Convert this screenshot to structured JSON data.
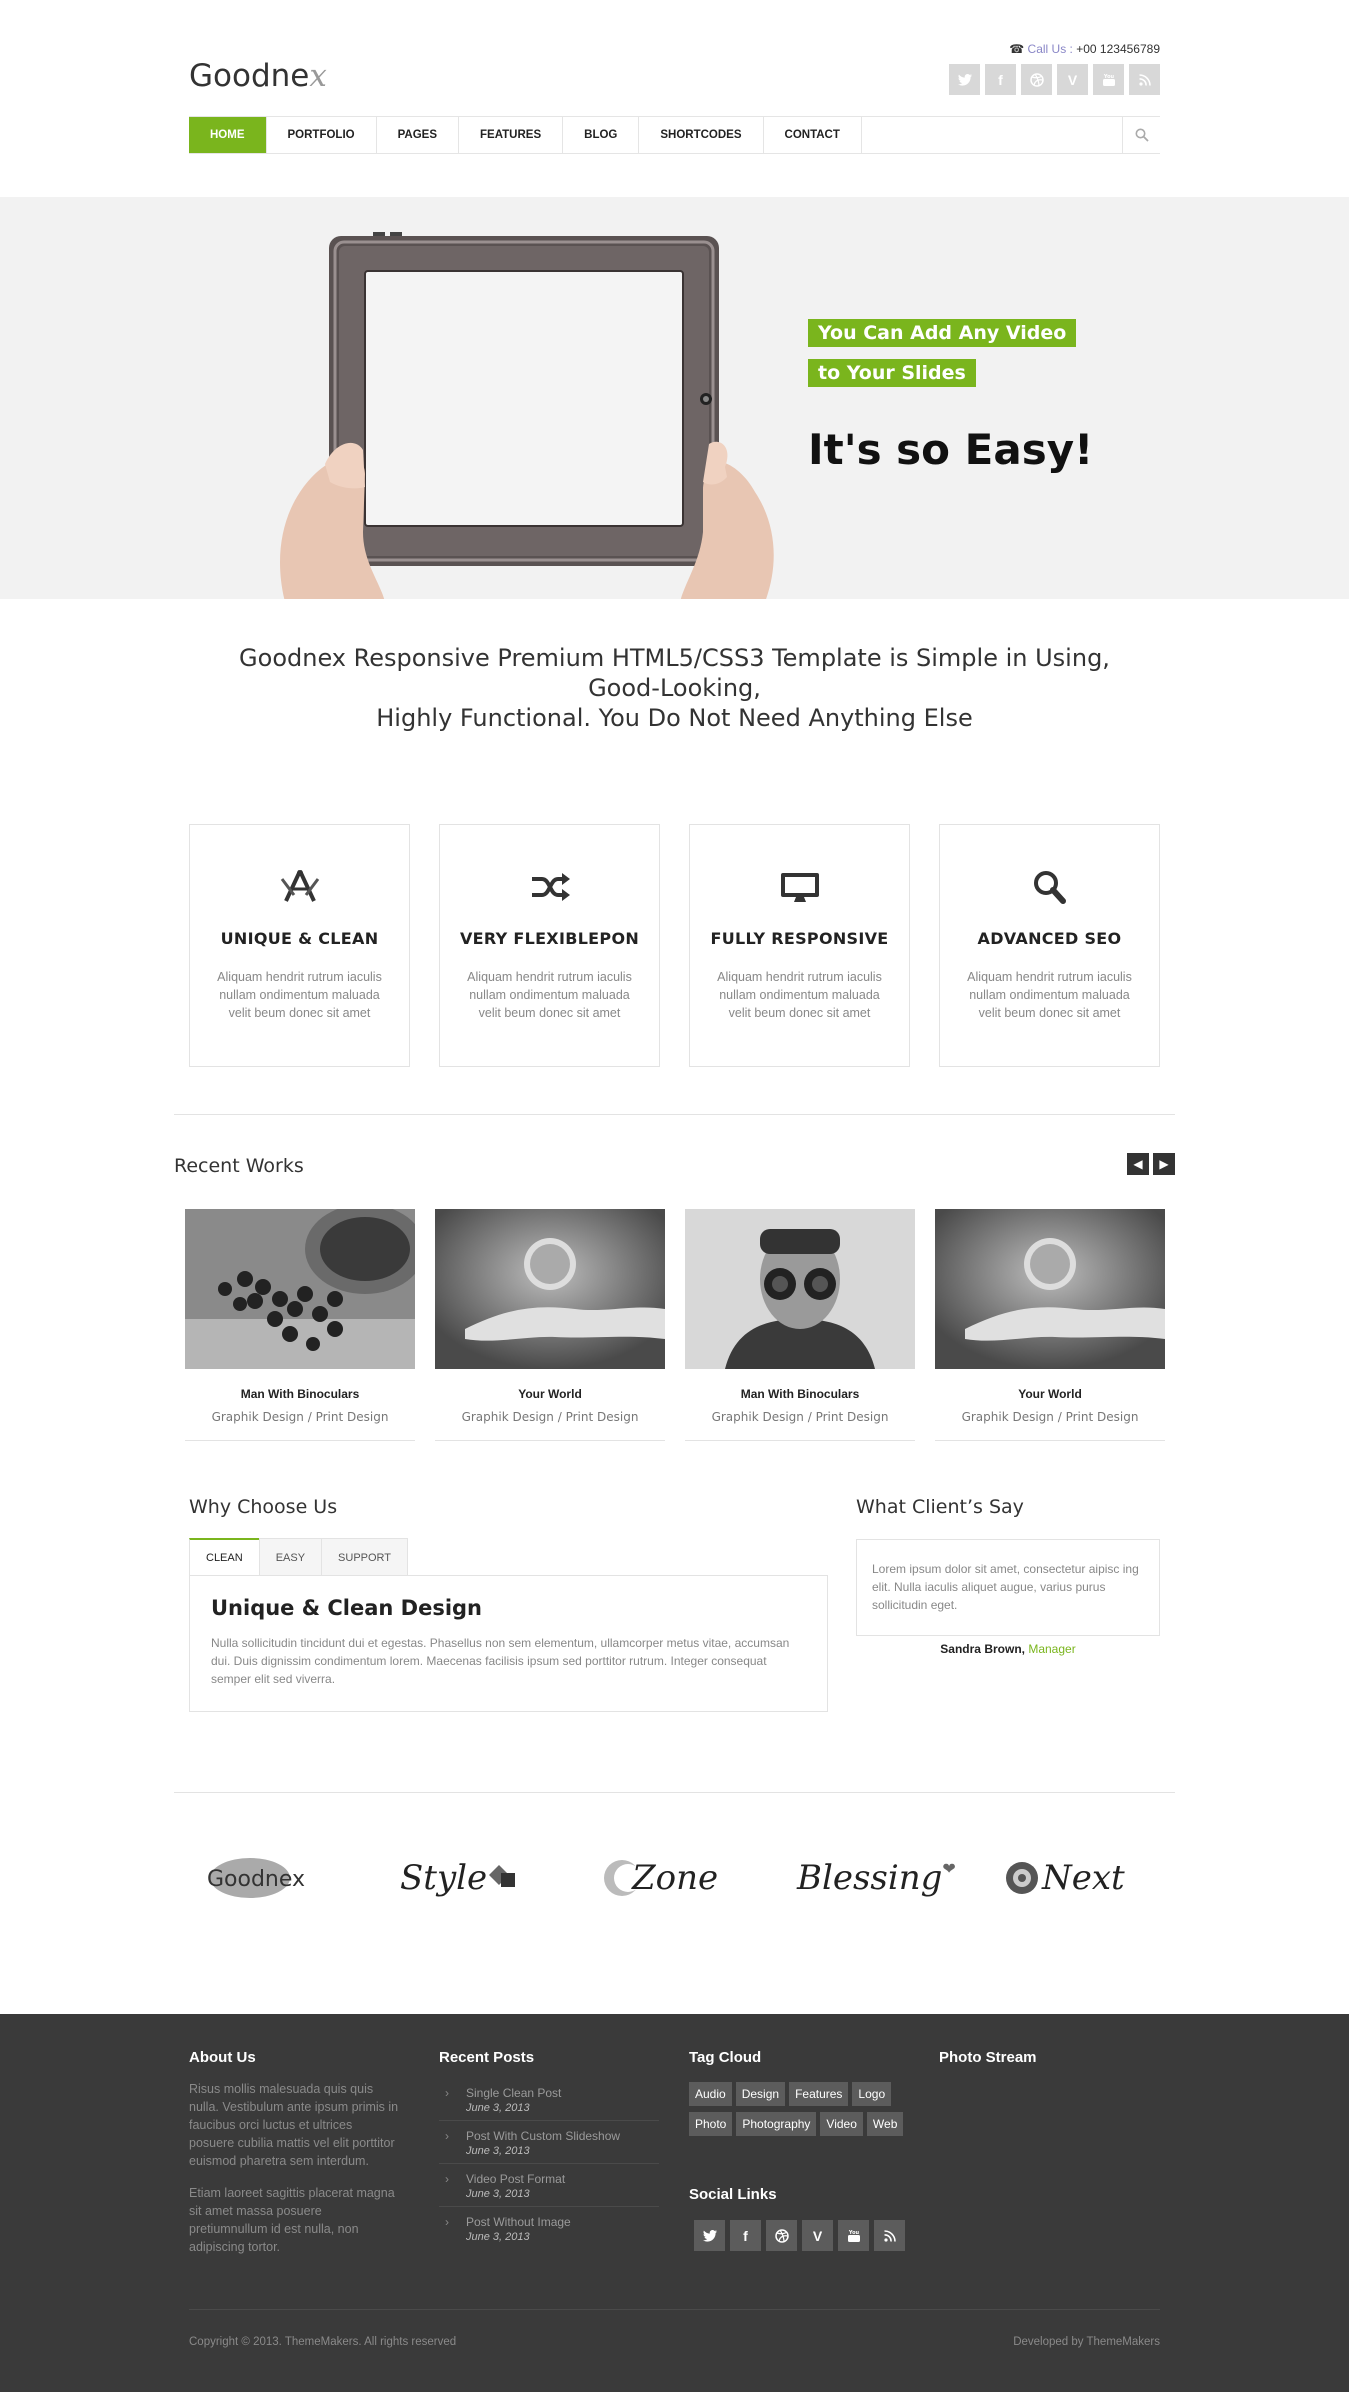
{
  "header": {
    "logo_main": "Goodne",
    "logo_x": "x",
    "call_label": "Call Us :",
    "call_number": "+00 123456789",
    "social_icons": [
      "twitter-icon",
      "facebook-icon",
      "dribbble-icon",
      "vimeo-icon",
      "youtube-icon",
      "rss-icon"
    ]
  },
  "nav": {
    "items": [
      "HOME",
      "PORTFOLIO",
      "PAGES",
      "FEATURES",
      "BLOG",
      "SHORTCODES",
      "CONTACT"
    ],
    "active": "HOME"
  },
  "hero": {
    "badge1": "You Can Add Any Video",
    "badge2": "to Your Slides",
    "headline": "It's so Easy!"
  },
  "intro": {
    "line1": "Goodnex Responsive Premium HTML5/CSS3 Template is Simple in Using,",
    "line2": "Good-Looking,",
    "line3": "Highly Functional. You Do Not Need Anything Else"
  },
  "features": [
    {
      "icon": "design-tools-icon",
      "title": "UNIQUE & CLEAN",
      "text": "Aliquam hendrit rutrum iaculis nullam ondimentum maluada velit beum donec sit amet"
    },
    {
      "icon": "shuffle-icon",
      "title": "VERY FLEXIBLEPON",
      "text": "Aliquam hendrit rutrum iaculis nullam ondimentum maluada velit beum donec sit amet"
    },
    {
      "icon": "monitor-icon",
      "title": "FULLY RESPONSIVE",
      "text": "Aliquam hendrit rutrum iaculis nullam ondimentum maluada velit beum donec sit amet"
    },
    {
      "icon": "magnifier-icon",
      "title": "ADVANCED SEO",
      "text": "Aliquam hendrit rutrum iaculis nullam ondimentum maluada velit beum donec sit amet"
    }
  ],
  "recent_works": {
    "title": "Recent Works",
    "items": [
      {
        "title": "Man With Binoculars",
        "category": "Graphik Design / Print Design"
      },
      {
        "title": "Your World",
        "category": "Graphik Design / Print Design"
      },
      {
        "title": "Man With Binoculars",
        "category": "Graphik Design / Print Design"
      },
      {
        "title": "Your World",
        "category": "Graphik Design / Print Design"
      }
    ]
  },
  "why": {
    "title": "Why Choose Us",
    "tabs": [
      "CLEAN",
      "EASY",
      "SUPPORT"
    ],
    "active_tab": "CLEAN",
    "panel_title": "Unique & Clean Design",
    "panel_text": "Nulla sollicitudin tincidunt dui et egestas. Phasellus non sem elementum, ullamcorper metus vitae, accumsan dui. Duis dignissim condimentum lorem. Maecenas facilisis ipsum sed porttitor rutrum. Integer consequat semper elit sed viverra."
  },
  "clients": {
    "title": "What Client’s Say",
    "quote": "Lorem ipsum dolor sit amet, consectetur aipisc ing elit. Nulla iaculis aliquet augue, varius purus sollicitudin eget.",
    "author": "Sandra Brown,",
    "role": "Manager"
  },
  "brands": [
    "Goodnex",
    "Style",
    "Zone",
    "Blessing",
    "Next"
  ],
  "footer": {
    "about_title": "About Us",
    "about_p1": "Risus mollis malesuada quis quis nulla. Vestibulum ante ipsum primis in faucibus orci luctus et ultrices posuere cubilia mattis vel elit porttitor euismod pharetra sem interdum.",
    "about_p2": "Etiam laoreet sagittis placerat magna sit amet massa posuere pretiumnullum id est nulla, non adipiscing tortor.",
    "posts_title": "Recent Posts",
    "posts": [
      {
        "title": "Single Clean Post",
        "date": "June 3, 2013"
      },
      {
        "title": "Post With Custom Slideshow",
        "date": "June 3, 2013"
      },
      {
        "title": "Video Post Format",
        "date": "June 3, 2013"
      },
      {
        "title": "Post Without Image",
        "date": "June 3, 2013"
      }
    ],
    "tags_title": "Tag Cloud",
    "tags": [
      "Audio",
      "Design",
      "Features",
      "Logo",
      "Photo",
      "Photography",
      "Video",
      "Web"
    ],
    "social_title": "Social Links",
    "photo_title": "Photo Stream",
    "copyright": "Copyright © 2013. ThemeMakers. All rights reserved",
    "developed": "Developed by ThemeMakers"
  },
  "colors": {
    "accent": "#7ab51d",
    "footer_bg": "#3a3a3a",
    "hero_bg": "#f2f2f2"
  }
}
